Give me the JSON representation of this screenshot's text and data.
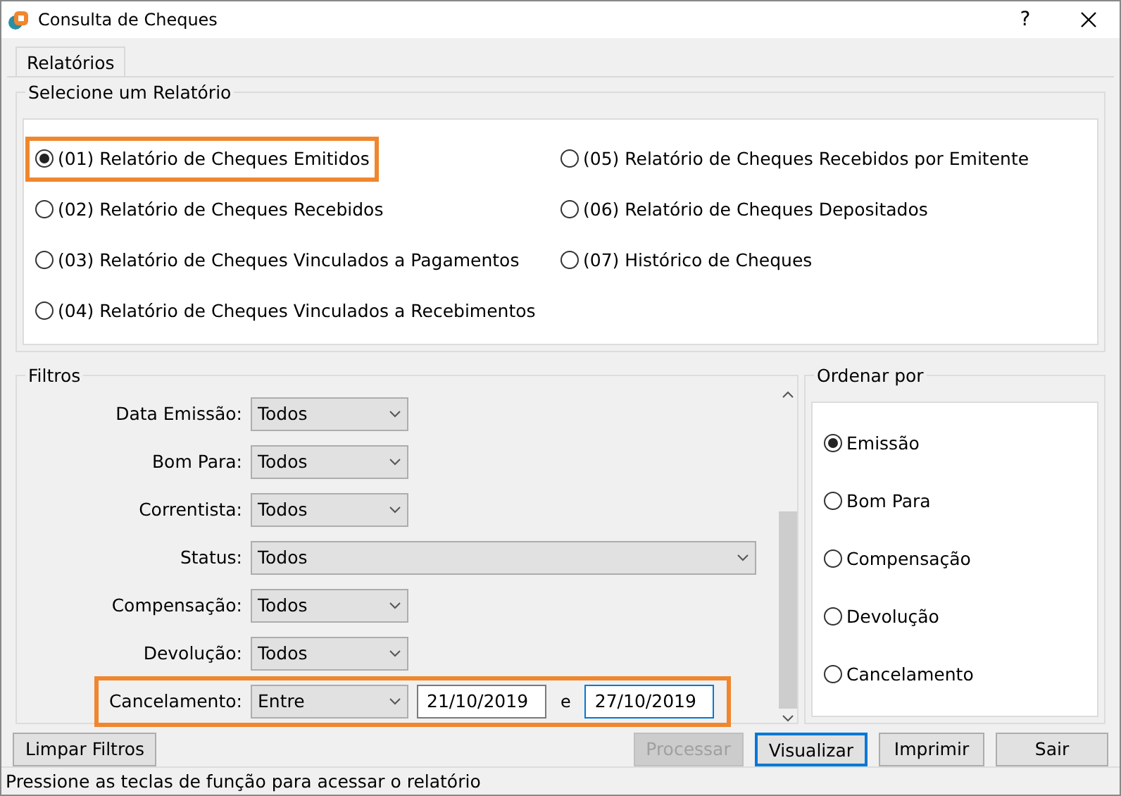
{
  "window": {
    "title": "Consulta de Cheques",
    "help": "?"
  },
  "tabs": [
    {
      "label": "Relatórios",
      "selected": true
    }
  ],
  "report_group": {
    "title": "Selecione um Relatório",
    "columns": [
      [
        {
          "label": "(01) Relatório de Cheques Emitidos",
          "selected": true,
          "highlighted": true
        },
        {
          "label": "(02) Relatório de Cheques Recebidos",
          "selected": false,
          "highlighted": false
        },
        {
          "label": "(03) Relatório de Cheques Vinculados a Pagamentos",
          "selected": false,
          "highlighted": false
        },
        {
          "label": "(04) Relatório de Cheques Vinculados a Recebimentos",
          "selected": false,
          "highlighted": false
        }
      ],
      [
        {
          "label": "(05) Relatório de Cheques Recebidos por Emitente",
          "selected": false,
          "highlighted": false
        },
        {
          "label": "(06) Relatório de Cheques Depositados",
          "selected": false,
          "highlighted": false
        },
        {
          "label": "(07) Histórico de Cheques",
          "selected": false,
          "highlighted": false
        }
      ]
    ]
  },
  "filters": {
    "title": "Filtros",
    "rows": [
      {
        "kind": "short",
        "label": "Data Emissão:",
        "value": "Todos",
        "highlighted": false
      },
      {
        "kind": "short",
        "label": "Bom Para:",
        "value": "Todos",
        "highlighted": false
      },
      {
        "kind": "short",
        "label": "Correntista:",
        "value": "Todos",
        "highlighted": false
      },
      {
        "kind": "wide",
        "label": "Status:",
        "value": "Todos",
        "highlighted": false
      },
      {
        "kind": "short",
        "label": "Compensação:",
        "value": "Todos",
        "highlighted": false
      },
      {
        "kind": "short",
        "label": "Devolução:",
        "value": "Todos",
        "highlighted": false
      },
      {
        "kind": "range",
        "label": "Cancelamento:",
        "value": "Entre",
        "from": "21/10/2019",
        "separator": "e",
        "to": "27/10/2019",
        "highlighted": true
      }
    ]
  },
  "sort": {
    "title": "Ordenar por",
    "options": [
      {
        "label": "Emissão",
        "selected": true
      },
      {
        "label": "Bom Para",
        "selected": false
      },
      {
        "label": "Compensação",
        "selected": false
      },
      {
        "label": "Devolução",
        "selected": false
      },
      {
        "label": "Cancelamento",
        "selected": false
      }
    ]
  },
  "left_buttons": [
    {
      "label": "Limpar Filtros",
      "disabled": false,
      "default": false
    }
  ],
  "right_buttons": [
    {
      "label": "Processar",
      "disabled": true,
      "default": false
    },
    {
      "label": "Visualizar",
      "disabled": false,
      "default": true
    },
    {
      "label": "Imprimir",
      "disabled": false,
      "default": false
    },
    {
      "label": "Sair",
      "disabled": false,
      "default": false
    }
  ],
  "status_bar": "Pressione as teclas de função para acessar o relatório"
}
